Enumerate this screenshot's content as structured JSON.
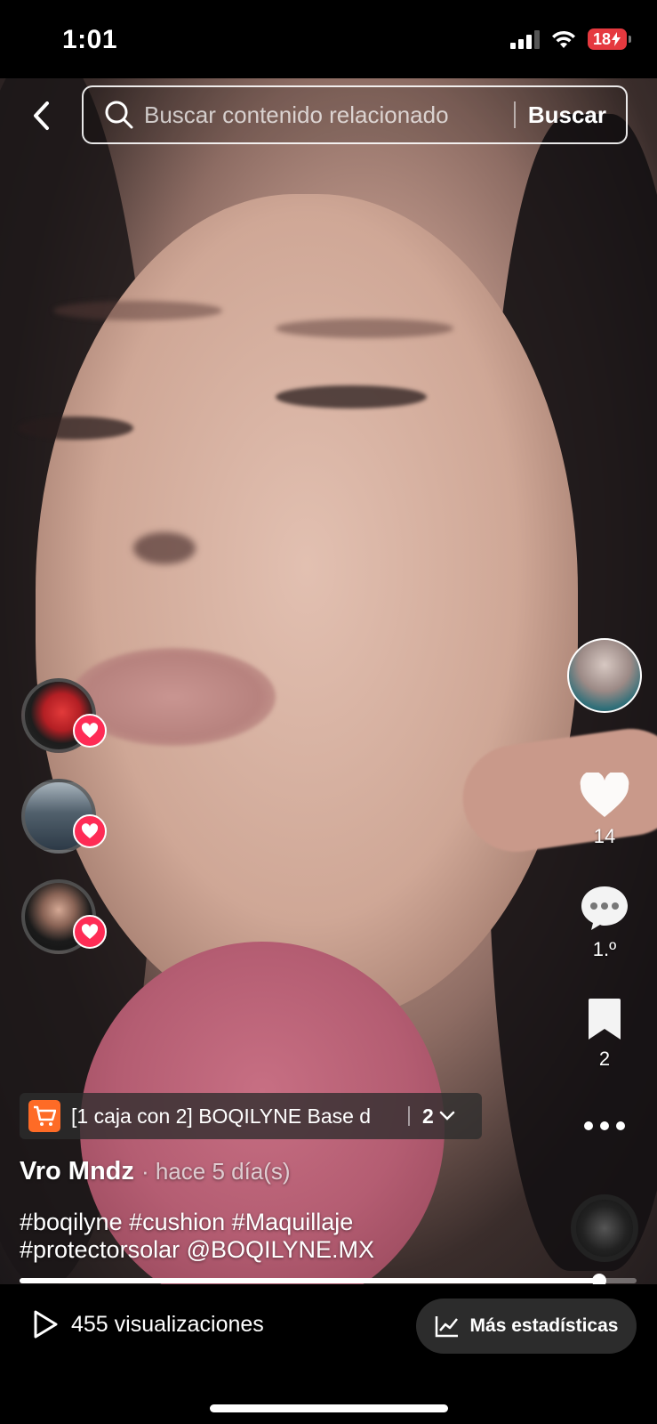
{
  "status_bar": {
    "time": "1:01",
    "battery": "18"
  },
  "search": {
    "placeholder": "Buscar contenido relacionado",
    "submit_label": "Buscar"
  },
  "likers": [
    {
      "icon": "heart-icon",
      "badge_color": "#fe2c55"
    },
    {
      "icon": "heart-icon",
      "badge_color": "#fe2c55"
    },
    {
      "icon": "heart-icon",
      "badge_color": "#fe2c55"
    }
  ],
  "actions": {
    "likes": "14",
    "comments": "1.º",
    "saves": "2"
  },
  "product": {
    "title": "[1 caja con 2] BOQILYNE Base d",
    "count": "2",
    "cart_color": "#fe6b26"
  },
  "post": {
    "author": "Vro Mndz",
    "time": "· hace 5 día(s)",
    "caption_line1": "#boqilyne  #cushion #Maquillaje",
    "caption_line2": "#protectorsolar @BOQILYNE.MX"
  },
  "playback": {
    "progress": 0.94
  },
  "footer": {
    "views": "455 visualizaciones",
    "stats_label": "Más estadísticas"
  }
}
